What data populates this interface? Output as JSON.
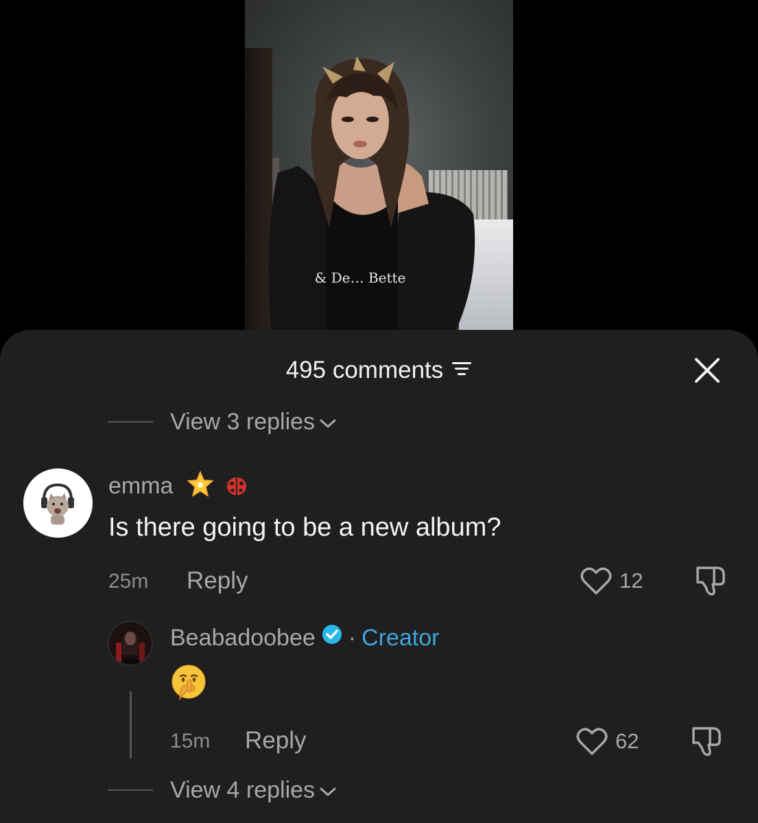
{
  "video": {
    "shirt_text": "& De… Bette"
  },
  "sheet": {
    "comments_count_label": "495 comments",
    "sort_icon": "sort-lines-icon",
    "close_icon": "close-x-icon"
  },
  "thread_top": {
    "view_replies_label": "View 3 replies"
  },
  "comment": {
    "username": "emma",
    "username_emojis": [
      "star-emoji",
      "ladybug-emoji"
    ],
    "text": "Is there going to be a new album?",
    "time": "25m",
    "reply_label": "Reply",
    "likes": "12"
  },
  "reply": {
    "username": "Beabadoobee",
    "separator": "·",
    "badge_label": "Creator",
    "text_emoji": "🤫",
    "time": "15m",
    "reply_label": "Reply",
    "likes": "62"
  },
  "thread_bottom": {
    "view_replies_label": "View 4 replies"
  },
  "colors": {
    "sheet_bg": "#1f1f1f",
    "creator_accent": "#3fa5de",
    "muted_text": "#a8a8a8"
  }
}
